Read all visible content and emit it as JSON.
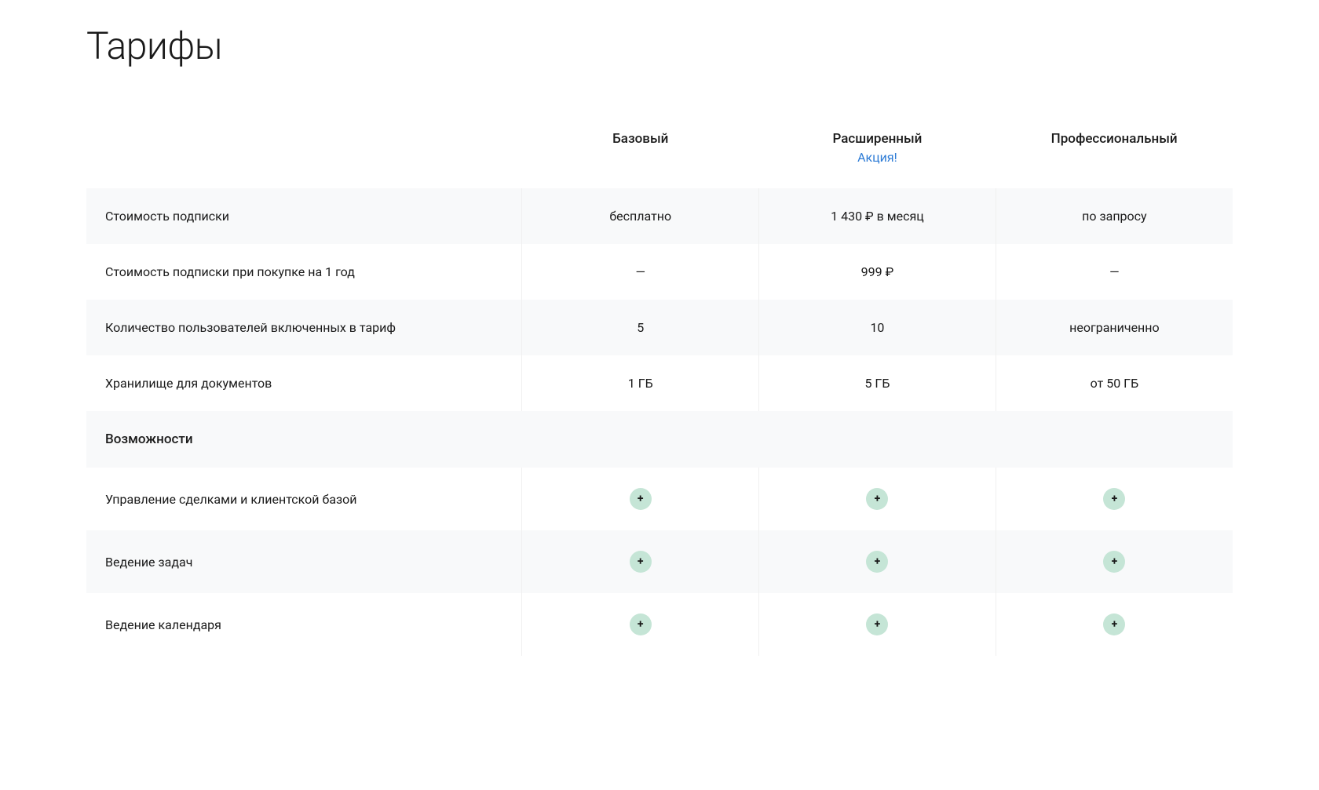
{
  "title": "Тарифы",
  "plans": [
    {
      "name": "Базовый",
      "badge": ""
    },
    {
      "name": "Расширенный",
      "badge": "Акция!"
    },
    {
      "name": "Профессиональный",
      "badge": ""
    }
  ],
  "rows": [
    {
      "type": "data",
      "label": "Стоимость подписки",
      "values": [
        "бесплатно",
        "1 430 ₽ в месяц",
        "по запросу"
      ]
    },
    {
      "type": "data",
      "label": "Стоимость подписки при покупке на 1 год",
      "values": [
        "—",
        "999 ₽",
        "—"
      ]
    },
    {
      "type": "data",
      "label": "Количество пользователей включенных в тариф",
      "values": [
        "5",
        "10",
        "неограниченно"
      ]
    },
    {
      "type": "data",
      "label": "Хранилище для документов",
      "values": [
        "1 ГБ",
        "5 ГБ",
        "от 50 ГБ"
      ]
    },
    {
      "type": "section",
      "label": "Возможности"
    },
    {
      "type": "feature",
      "label": "Управление сделками и клиентской базой",
      "values": [
        true,
        true,
        true
      ]
    },
    {
      "type": "feature",
      "label": "Ведение задач",
      "values": [
        true,
        true,
        true
      ]
    },
    {
      "type": "feature",
      "label": "Ведение календаря",
      "values": [
        true,
        true,
        true
      ]
    }
  ],
  "check_glyph": "+"
}
